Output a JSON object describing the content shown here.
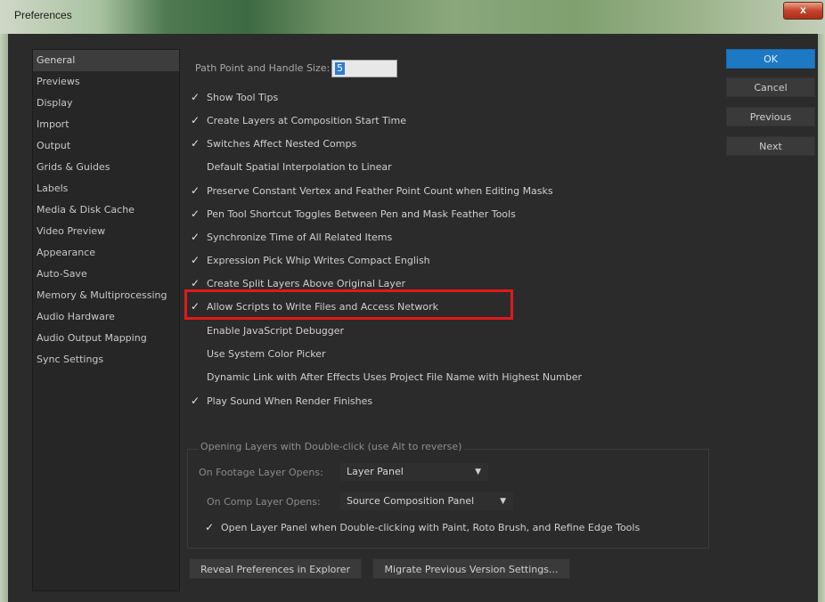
{
  "window": {
    "title": "Preferences",
    "close_label": "x"
  },
  "sidebar": {
    "items": [
      {
        "label": "General",
        "selected": true
      },
      {
        "label": "Previews"
      },
      {
        "label": "Display"
      },
      {
        "label": "Import"
      },
      {
        "label": "Output"
      },
      {
        "label": "Grids & Guides"
      },
      {
        "label": "Labels"
      },
      {
        "label": "Media & Disk Cache"
      },
      {
        "label": "Video Preview"
      },
      {
        "label": "Appearance"
      },
      {
        "label": "Auto-Save"
      },
      {
        "label": "Memory & Multiprocessing"
      },
      {
        "label": "Audio Hardware"
      },
      {
        "label": "Audio Output Mapping"
      },
      {
        "label": "Sync Settings"
      }
    ]
  },
  "general": {
    "path_label": "Path Point and Handle Size:",
    "path_value": "5",
    "options": [
      {
        "label": "Show Tool Tips",
        "checked": true
      },
      {
        "label": "Create Layers at Composition Start Time",
        "checked": true
      },
      {
        "label": "Switches Affect Nested Comps",
        "checked": true
      },
      {
        "label": "Default Spatial Interpolation to Linear",
        "checked": false
      },
      {
        "label": "Preserve Constant Vertex and Feather Point Count when Editing Masks",
        "checked": true
      },
      {
        "label": "Pen Tool Shortcut Toggles Between Pen and Mask Feather Tools",
        "checked": true
      },
      {
        "label": "Synchronize Time of All Related Items",
        "checked": true
      },
      {
        "label": "Expression Pick Whip Writes Compact English",
        "checked": true
      },
      {
        "label": "Create Split Layers Above Original Layer",
        "checked": true
      },
      {
        "label": "Allow Scripts to Write Files and Access Network",
        "checked": true,
        "highlighted": true
      },
      {
        "label": "Enable JavaScript Debugger",
        "checked": false
      },
      {
        "label": "Use System Color Picker",
        "checked": false
      },
      {
        "label": "Dynamic Link with After Effects Uses Project File Name with Highest Number",
        "checked": false
      },
      {
        "label": "Play Sound When Render Finishes",
        "checked": true
      }
    ],
    "check_glyph": "✓",
    "double_click_group": {
      "label": "Opening Layers with Double-click (use Alt to reverse)",
      "footage_label": "On Footage Layer Opens:",
      "footage_value": "Layer Panel",
      "comp_label": "On Comp Layer Opens:",
      "comp_value": "Source Composition Panel",
      "dropdown_arrow": "▼",
      "open_layer_panel_label": "Open Layer Panel when Double-clicking with Paint, Roto Brush, and Refine Edge Tools",
      "open_layer_panel_checked": true
    },
    "reveal_button": "Reveal Preferences in Explorer",
    "migrate_button": "Migrate Previous Version Settings..."
  },
  "buttons": {
    "ok": "OK",
    "cancel": "Cancel",
    "previous": "Previous",
    "next": "Next"
  },
  "colors": {
    "accent": "#1e79c4",
    "highlight": "#e11a1a"
  }
}
